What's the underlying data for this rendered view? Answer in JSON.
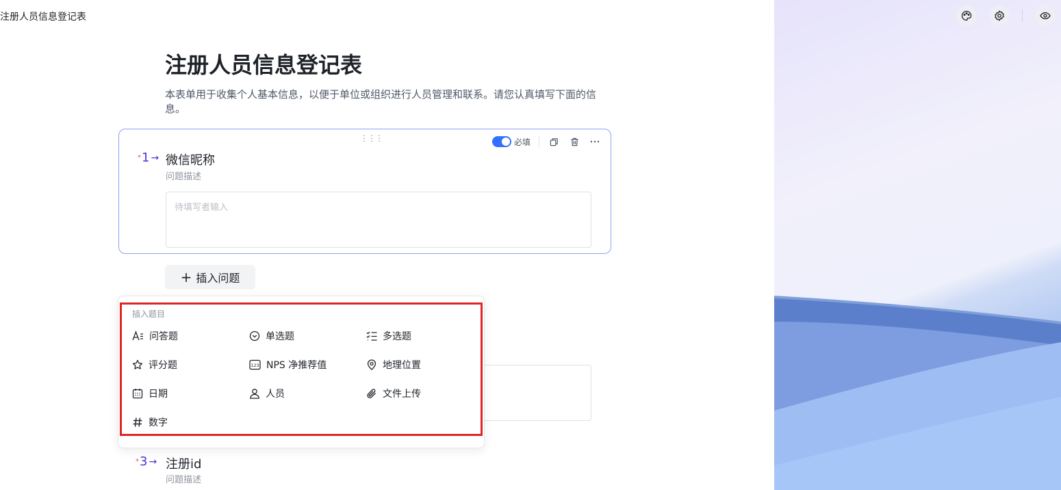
{
  "header": {
    "title": "注册人员信息登记表"
  },
  "form": {
    "title": "注册人员信息登记表",
    "description": "本表单用于收集个人基本信息，以便于单位或组织进行人员管理和联系。请您认真填写下面的信息。"
  },
  "question1": {
    "number": "1",
    "title": "微信昵称",
    "description": "问题描述",
    "placeholder": "待填写者输入",
    "required_label": "必填",
    "drag_glyph": "⋮⋮⋮"
  },
  "insert_button": {
    "label": "插入问题"
  },
  "dropdown": {
    "header": "插入题目",
    "items": [
      {
        "label": "问答题",
        "icon": "text-answer-icon"
      },
      {
        "label": "单选题",
        "icon": "single-choice-icon"
      },
      {
        "label": "多选题",
        "icon": "multi-choice-icon"
      },
      {
        "label": "评分题",
        "icon": "star-icon"
      },
      {
        "label": "NPS 净推荐值",
        "icon": "nps-icon"
      },
      {
        "label": "地理位置",
        "icon": "location-icon"
      },
      {
        "label": "日期",
        "icon": "calendar-icon"
      },
      {
        "label": "人员",
        "icon": "person-icon"
      },
      {
        "label": "文件上传",
        "icon": "attachment-icon"
      },
      {
        "label": "数字",
        "icon": "hash-icon"
      }
    ]
  },
  "question3": {
    "number": "3",
    "title": "注册id",
    "description": "问题描述"
  },
  "colors": {
    "accent": "#3370ff",
    "number": "#4c2fdb",
    "required": "#f54a45",
    "highlight": "#e02424"
  }
}
